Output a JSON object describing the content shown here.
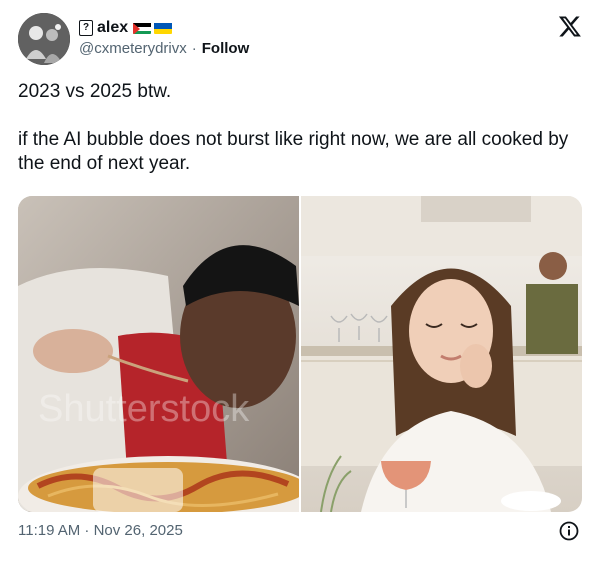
{
  "author": {
    "display_name": "alex",
    "name_glyph": "?",
    "handle": "@cxmeterydrivx",
    "separator": "·",
    "follow_label": "Follow",
    "avatar_icon": "avatar-photo",
    "flags": [
      "palestine-flag",
      "ukraine-flag"
    ]
  },
  "tweet": {
    "line1": "2023 vs 2025 btw.",
    "line2": "if the AI bubble does not burst like right now, we are all cooked by the end of next year."
  },
  "media": {
    "left_photo": "man-eating-spaghetti-photo",
    "right_photo": "woman-at-restaurant-photo",
    "watermark": "Shutterstock"
  },
  "footer": {
    "timestamp": "11:19 AM · Nov 26, 2025"
  },
  "colors": {
    "text": "#0f1419",
    "secondary": "#536471"
  }
}
